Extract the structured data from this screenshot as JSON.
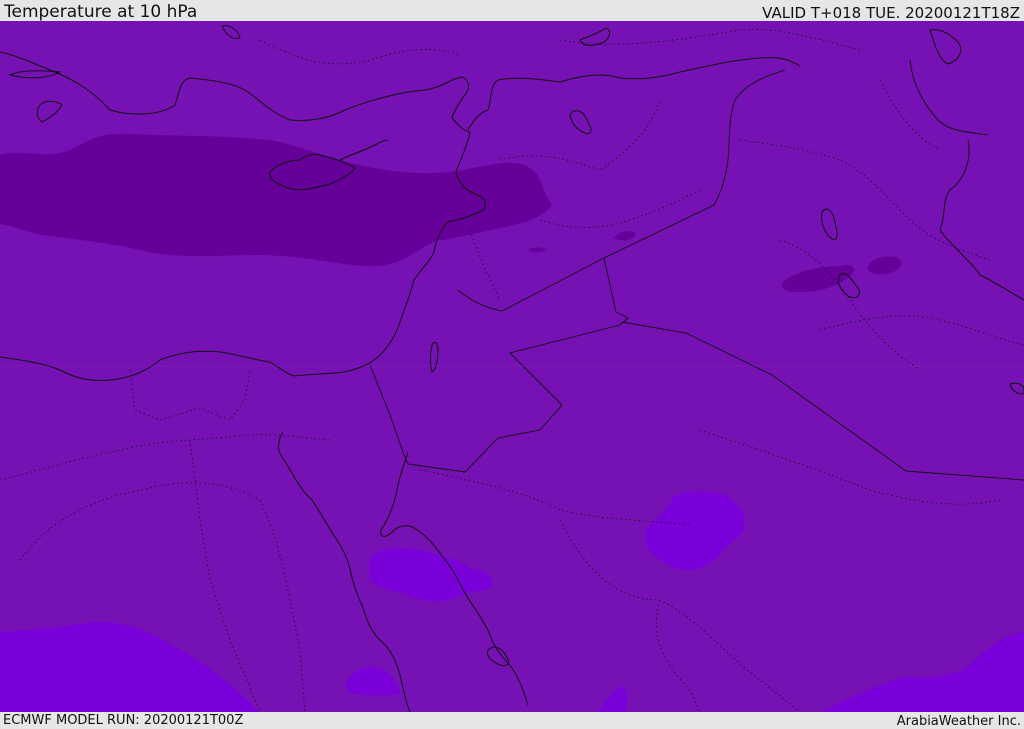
{
  "header": {
    "title": "Temperature at 10 hPa",
    "valid": "VALID T+018 TUE. 20200121T18Z"
  },
  "footer": {
    "model_run": "ECMWF MODEL RUN: 20200121T00Z",
    "credit": "ArabiaWeather Inc."
  },
  "colors": {
    "background_field": "#7612b3",
    "cold_contour": "#650099",
    "warm_contour": "#7a00d9",
    "coastline": "#111111",
    "bars": "#e6e6e6"
  }
}
